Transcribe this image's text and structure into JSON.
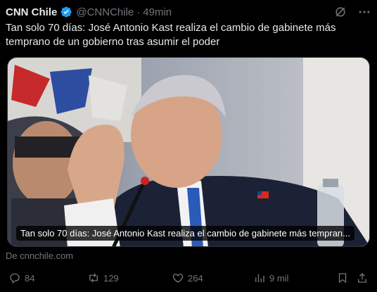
{
  "tweet": {
    "author_name": "CNN Chile",
    "handle": "@CNNChile",
    "separator": "·",
    "time": "49min",
    "text": "Tan solo 70 días: José Antonio Kast realiza el cambio de gabinete más temprano de un gobierno tras asumir el poder"
  },
  "card": {
    "caption": "Tan solo 70 días: José Antonio Kast realiza el cambio de gabinete más tempran...",
    "source": "De cnnchile.com"
  },
  "actions": {
    "replies": "84",
    "reposts": "129",
    "likes": "264",
    "views": "9 mil"
  },
  "icons": {
    "verified": "verified-badge-icon",
    "grok": "grok-icon",
    "more": "more-icon",
    "reply": "reply-icon",
    "repost": "repost-icon",
    "like": "heart-icon",
    "views": "views-icon",
    "bookmark": "bookmark-icon",
    "share": "share-icon"
  },
  "colors": {
    "background": "#000000",
    "text": "#e7e9ea",
    "muted": "#71767b",
    "verified": "#1d9bf0"
  }
}
